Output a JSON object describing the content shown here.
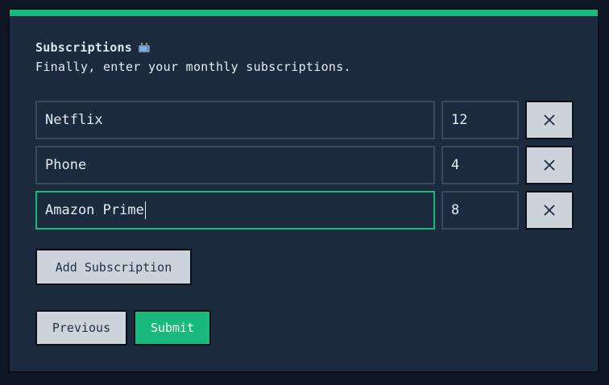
{
  "colors": {
    "accent": "#19b87c",
    "background": "#1c2a3e",
    "page_background": "#0f1726",
    "button_light": "#cdd3db"
  },
  "header": {
    "title": "Subscriptions",
    "title_icon": "tv-icon",
    "subtitle": "Finally, enter your monthly subscriptions."
  },
  "subscriptions": [
    {
      "name": "Netflix",
      "amount": "12",
      "remove_icon": "close-icon"
    },
    {
      "name": "Phone",
      "amount": "4",
      "remove_icon": "close-icon"
    },
    {
      "name": "Amazon Prime",
      "amount": "8",
      "remove_icon": "close-icon"
    }
  ],
  "actions": {
    "add_label": "Add Subscription",
    "previous_label": "Previous",
    "submit_label": "Submit"
  }
}
